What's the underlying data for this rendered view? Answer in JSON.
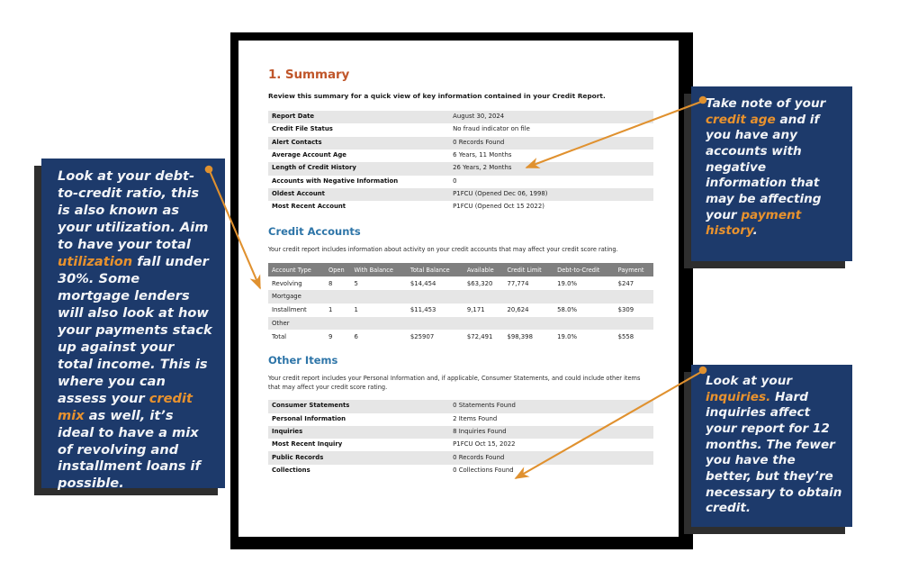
{
  "document": {
    "section_number_title": "1. Summary",
    "intro": "Review this summary for a quick view  of key information contained in your Credit Report.",
    "summary_rows": [
      {
        "label": "Report Date",
        "value": "August 30, 2024"
      },
      {
        "label": "Credit File Status",
        "value": "No fraud indicator  on file"
      },
      {
        "label": "Alert Contacts",
        "value": "0 Records Found"
      },
      {
        "label": "Average Account Age",
        "value": "6 Years, 11 Months"
      },
      {
        "label": "Length of Credit History",
        "value": "26 Years, 2 Months"
      },
      {
        "label": "Accounts with Negative Information",
        "value": "0"
      },
      {
        "label": "Oldest Account",
        "value": "P1FCU (Opened Dec 06, 1998)"
      },
      {
        "label": "Most Recent Account",
        "value": "P1FCU (Opened Oct 15 2022)"
      }
    ],
    "credit_accounts": {
      "heading": "Credit Accounts",
      "description": "Your credit report includes information about activity on your credit accounts that may affect your credit score rating.",
      "columns": [
        "Account Type",
        "Open",
        "With Balance",
        "Total Balance",
        "Available",
        "Credit Limit",
        "Debt-to-Credit",
        "Payment"
      ],
      "rows": [
        [
          "Revolving",
          "8",
          "5",
          "$14,454",
          "$63,320",
          "77,774",
          "19.0%",
          "$247"
        ],
        [
          "Mortgage",
          "",
          "",
          "",
          "",
          "",
          "",
          ""
        ],
        [
          "Installment",
          "1",
          "1",
          "$11,453",
          "9,171",
          "20,624",
          "58.0%",
          "$309"
        ],
        [
          "Other",
          "",
          "",
          "",
          "",
          "",
          "",
          ""
        ],
        [
          "Total",
          "9",
          "6",
          "$25907",
          "$72,491",
          "$98,398",
          "19.0%",
          "$558"
        ]
      ]
    },
    "other_items": {
      "heading": "Other Items",
      "description": "Your credit report includes your Personal Information and, if applicable, Consumer Statements, and could include other items that may affect your credit score rating.",
      "rows": [
        {
          "label": "Consumer Statements",
          "value": "0 Statements Found"
        },
        {
          "label": "Personal Information",
          "value": "2 Items Found"
        },
        {
          "label": "Inquiries",
          "value": "8 Inquiries Found"
        },
        {
          "label": "Most Recent Inquiry",
          "value": "P1FCU Oct 15,  2022"
        },
        {
          "label": "Public Records",
          "value": "0 Records Found"
        },
        {
          "label": "Collections",
          "value": "0 Collections Found"
        }
      ]
    }
  },
  "annotations": {
    "left": {
      "part1": "Look at your debt-to-credit ratio, this is also known as your utilization. Aim to have your total ",
      "highlight1": "utilization",
      "part2": " fall under 30%. Some mortgage lenders will also look at how your payments stack up against your total income. This is where you can assess your ",
      "highlight2": "credit mix",
      "part3": " as well, it’s ideal to have a mix of revolving and installment loans if possible."
    },
    "top_right": {
      "part1": "Take note of your ",
      "highlight1": "credit age",
      "part2": " and if you have any accounts with negative information that may be affecting your ",
      "highlight2": "payment history",
      "part3": "."
    },
    "bottom_right": {
      "part1": "Look at your ",
      "highlight1": "inquiries.",
      "part2": " Hard inquiries affect your report for 12 months. The fewer you have the better, but they’re necessary to obtain credit."
    }
  },
  "colors": {
    "callout_navy": "#1d3a6b",
    "highlight_orange": "#E8922E",
    "arrow_orange": "#E0912F",
    "section_title_rust": "#C0562A",
    "subheading_blue": "#2E75A8",
    "table_header_gray": "#7f7f7f",
    "row_shade_gray": "#e6e6e6"
  }
}
